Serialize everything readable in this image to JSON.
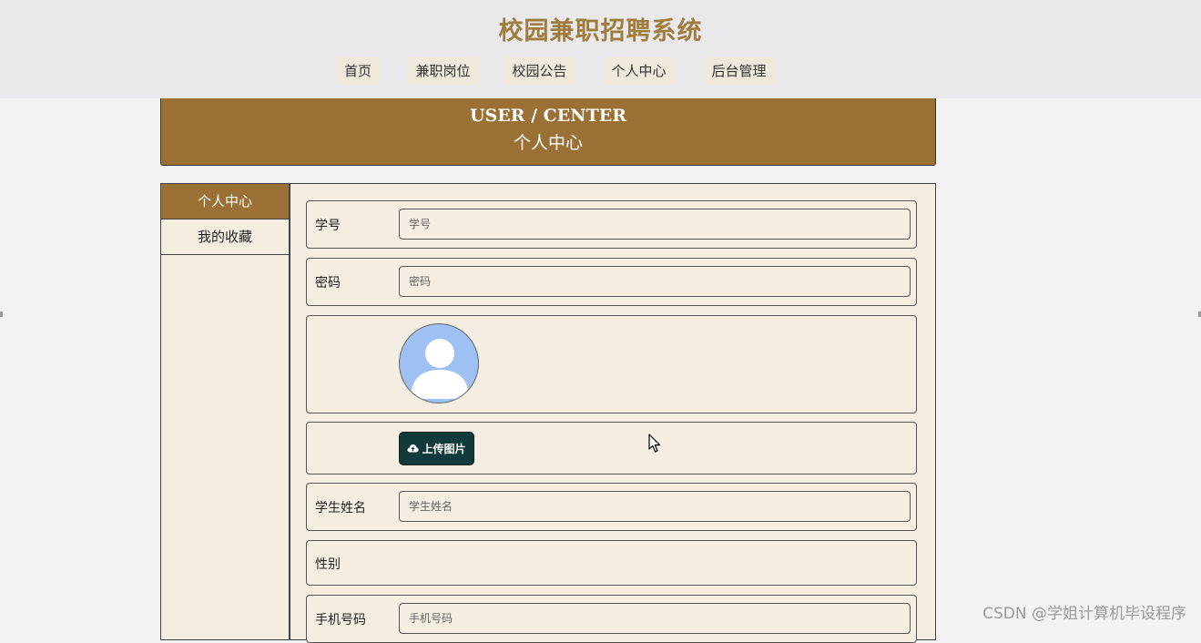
{
  "header": {
    "site_title": "校园兼职招聘系统",
    "nav": [
      "首页",
      "兼职岗位",
      "校园公告",
      "个人中心",
      "后台管理"
    ]
  },
  "banner": {
    "en": "USER / CENTER",
    "cn": "个人中心"
  },
  "sidebar": {
    "items": [
      "个人中心",
      "我的收藏"
    ],
    "active_index": 0
  },
  "form": {
    "student_id": {
      "label": "学号",
      "placeholder": "学号"
    },
    "password": {
      "label": "密码",
      "placeholder": "密码"
    },
    "avatar_icon": "user-avatar-placeholder",
    "upload": {
      "label": "上传图片",
      "icon": "cloud-upload-icon"
    },
    "student_name": {
      "label": "学生姓名",
      "placeholder": "学生姓名"
    },
    "gender": {
      "label": "性别"
    },
    "phone": {
      "label": "手机号码",
      "placeholder": "手机号码"
    }
  },
  "colors": {
    "accent": "#9a7034",
    "title": "#a07c3e",
    "panel_bg": "#f4ede1",
    "upload_button": "#113a3a"
  },
  "watermark": "CSDN @学姐计算机毕设程序"
}
